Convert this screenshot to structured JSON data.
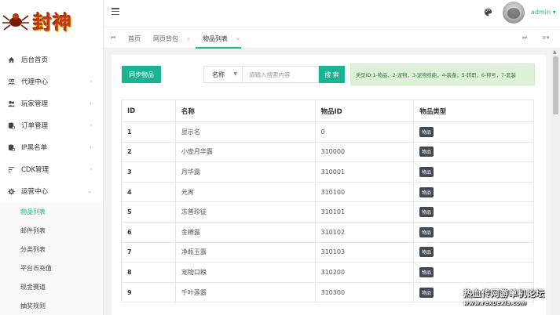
{
  "logo": {
    "text": "封神"
  },
  "sidebar": {
    "items": [
      {
        "label": "后台首页",
        "icon": "home-icon",
        "has_children": false
      },
      {
        "label": "代理中心",
        "icon": "users-icon",
        "has_children": true
      },
      {
        "label": "玩家管理",
        "icon": "user-group-icon",
        "has_children": true
      },
      {
        "label": "订单管理",
        "icon": "database-icon",
        "has_children": true
      },
      {
        "label": "IP黑名单",
        "icon": "database-icon",
        "has_children": true
      },
      {
        "label": "CDK管理",
        "icon": "list-icon",
        "has_children": true
      },
      {
        "label": "运营中心",
        "icon": "gear-icon",
        "has_children": true,
        "expanded": true
      }
    ],
    "submenu": [
      {
        "label": "物品列表",
        "active": true
      },
      {
        "label": "邮件列表",
        "active": false
      },
      {
        "label": "分类列表",
        "active": false
      },
      {
        "label": "平台币充值",
        "active": false
      },
      {
        "label": "现金赛道",
        "active": false
      },
      {
        "label": "抽奖规则",
        "active": false
      }
    ]
  },
  "header": {
    "username": "admin"
  },
  "tabs": [
    {
      "label": "首页",
      "closable": false
    },
    {
      "label": "网页背包",
      "closable": true
    },
    {
      "label": "物品列表",
      "closable": true,
      "active": true
    }
  ],
  "toolbar": {
    "sync_label": "同步物品",
    "select_value": "名称",
    "search_placeholder": "请输入搜索内容",
    "search_label": "搜 索",
    "type_note": "类型ID:1-物品，2-宠物，3-宠物技能，4-装备，5-转职，6-称号，7-套装"
  },
  "table": {
    "headers": [
      "ID",
      "名称",
      "物品ID",
      "物品类型"
    ],
    "rows": [
      {
        "id": "1",
        "name": "显示名",
        "item_id": "0",
        "type": "物品"
      },
      {
        "id": "2",
        "name": "小壶月华露",
        "item_id": "310000",
        "type": "物品"
      },
      {
        "id": "3",
        "name": "月华露",
        "item_id": "310001",
        "type": "物品"
      },
      {
        "id": "4",
        "name": "元宵",
        "item_id": "310100",
        "type": "物品"
      },
      {
        "id": "5",
        "name": "冻普珍徒",
        "item_id": "310101",
        "type": "物品"
      },
      {
        "id": "6",
        "name": "金樽露",
        "item_id": "310102",
        "type": "物品"
      },
      {
        "id": "7",
        "name": "净瓶玉露",
        "item_id": "310103",
        "type": "物品"
      },
      {
        "id": "8",
        "name": "宠物口粮",
        "item_id": "310200",
        "type": "物品"
      },
      {
        "id": "9",
        "name": "千叶莲露",
        "item_id": "310300",
        "type": "物品"
      }
    ]
  },
  "watermark": {
    "cn": "热血传网游单机论坛",
    "url": "www.rexuexia.com"
  },
  "colors": {
    "accent": "#1ab394",
    "badge": "#3f4a55",
    "note_bg": "#dff0d8"
  }
}
